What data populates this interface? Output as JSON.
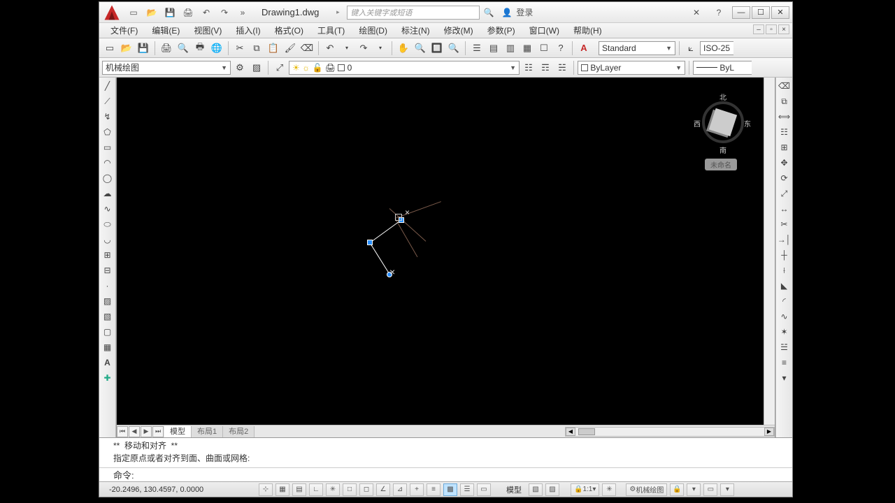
{
  "title": "Drawing1.dwg",
  "search_placeholder": "键入关键字或短语",
  "login_label": "登录",
  "menus": [
    "文件(F)",
    "编辑(E)",
    "视图(V)",
    "插入(I)",
    "格式(O)",
    "工具(T)",
    "绘图(D)",
    "标注(N)",
    "修改(M)",
    "参数(P)",
    "窗口(W)",
    "帮助(H)"
  ],
  "layer_combo": "机械绘图",
  "layer_state_text": "0",
  "style_combo": "Standard",
  "dim_combo": "ISO-25",
  "bylayer_label": "ByLayer",
  "linetype_label": "ByL",
  "tabs": {
    "model": "模型",
    "layout1": "布局1",
    "layout2": "布局2"
  },
  "viewcube": {
    "n": "北",
    "s": "南",
    "w": "西",
    "e": "东",
    "tag": "未命名"
  },
  "cmd_hist_line1": "**  移动和对齐  **",
  "cmd_hist_line2": "指定原点或者对齐到面、曲面或网格:",
  "cmd_prompt": "命令:",
  "coords": "-20.2496,   130.4597,   0.0000",
  "status_model": "模型",
  "status_scale": "1:1",
  "status_ws": "机械绘图"
}
